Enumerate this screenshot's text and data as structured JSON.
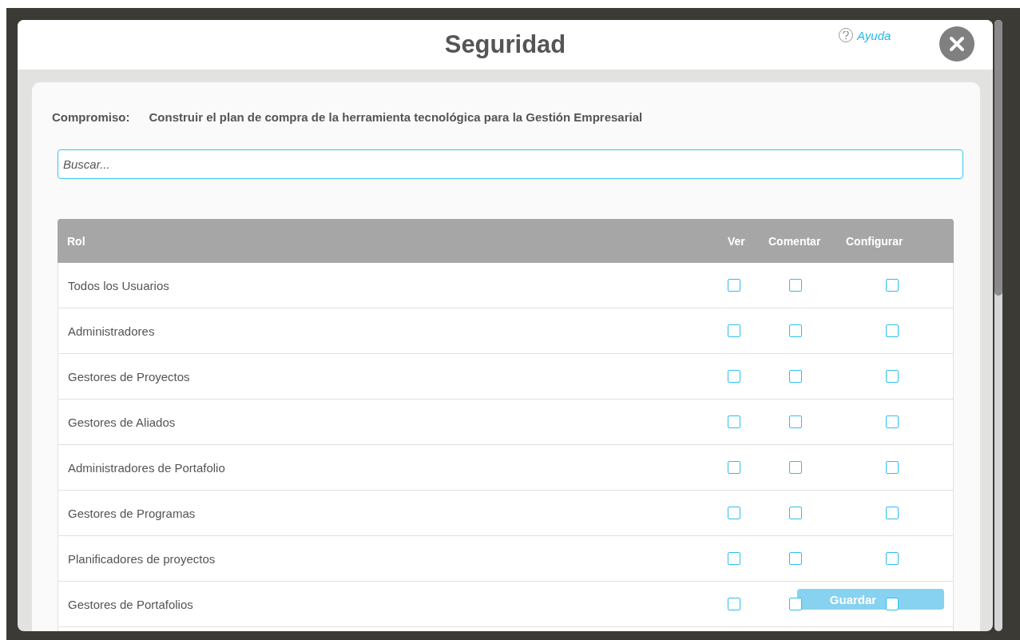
{
  "dialog": {
    "title": "Seguridad",
    "help_link": "Ayuda"
  },
  "commitment": {
    "label": "Compromiso:",
    "value": "Construir el plan de compra de la herramienta tecnológica para la Gestión Empresarial"
  },
  "search": {
    "placeholder": "Buscar..."
  },
  "table": {
    "columns": [
      "Rol",
      "Ver",
      "Comentar",
      "Configurar"
    ],
    "rows": [
      {
        "role": "Todos los Usuarios",
        "ver": false,
        "comentar": false,
        "configurar": false
      },
      {
        "role": "Administradores",
        "ver": false,
        "comentar": false,
        "configurar": false
      },
      {
        "role": "Gestores de Proyectos",
        "ver": false,
        "comentar": false,
        "configurar": false
      },
      {
        "role": "Gestores de Aliados",
        "ver": false,
        "comentar": false,
        "configurar": false
      },
      {
        "role": "Administradores de Portafolio",
        "ver": false,
        "comentar": false,
        "configurar": false
      },
      {
        "role": "Gestores de Programas",
        "ver": false,
        "comentar": false,
        "configurar": false
      },
      {
        "role": "Planificadores de proyectos",
        "ver": false,
        "comentar": false,
        "configurar": false
      },
      {
        "role": "Gestores de Portafolios",
        "ver": false,
        "comentar": false,
        "configurar": false
      }
    ]
  },
  "save_button": {
    "label": "Guardar",
    "disabled": true
  }
}
